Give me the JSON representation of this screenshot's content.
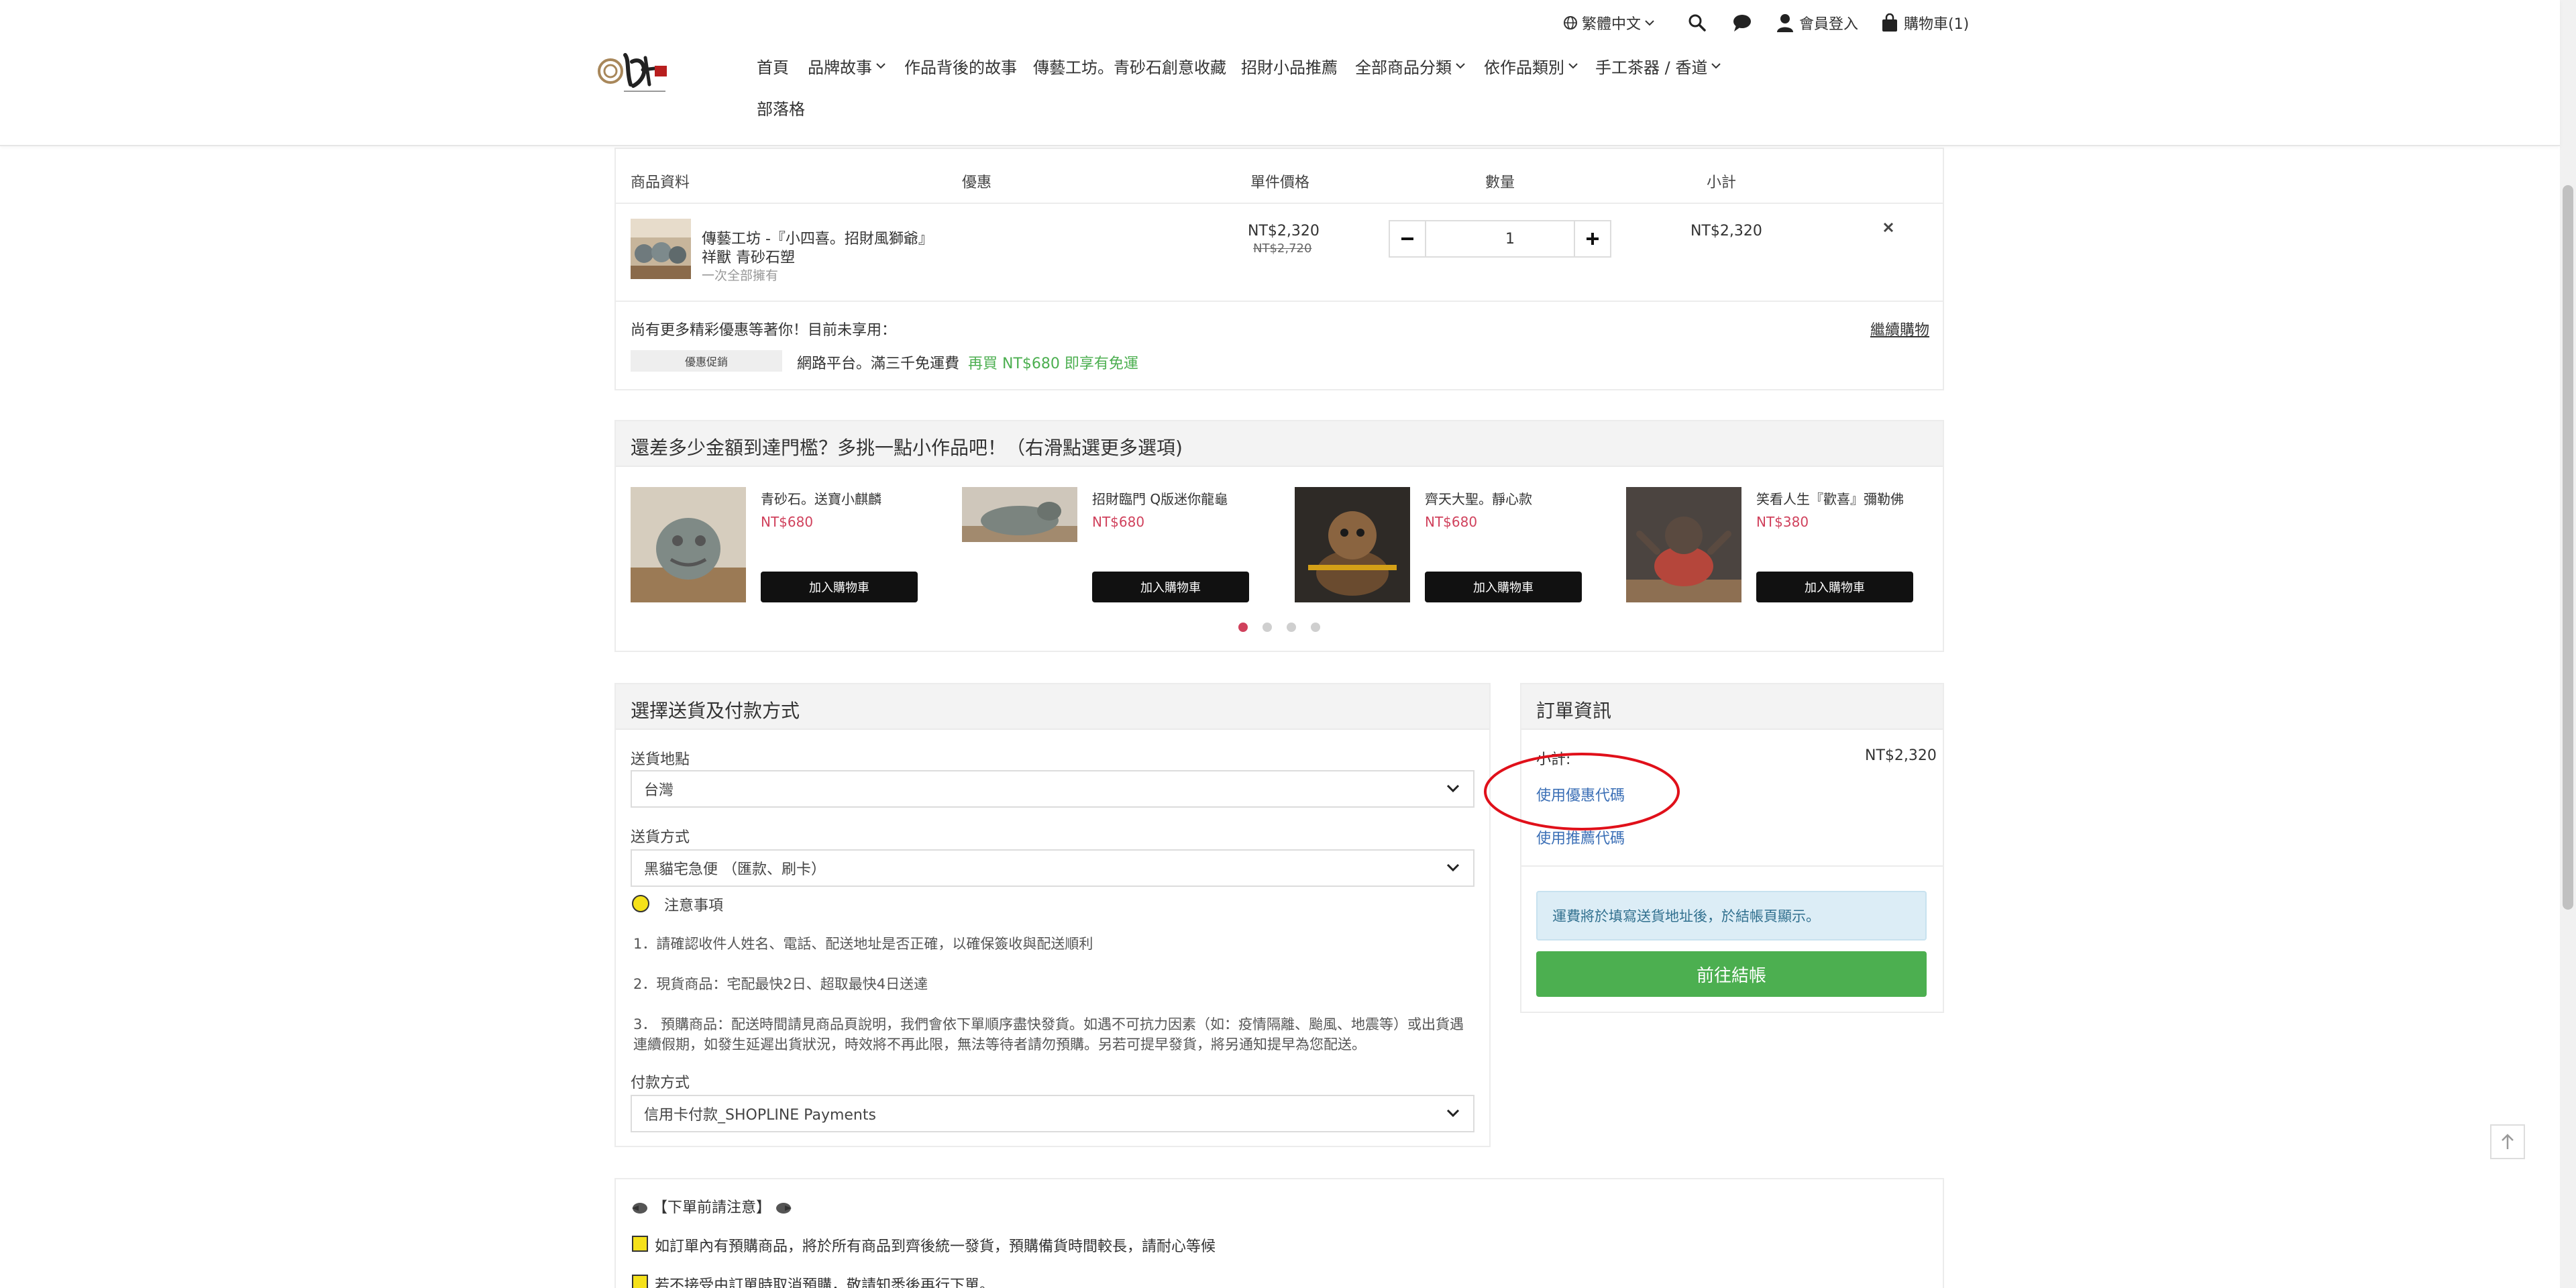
{
  "header": {
    "language": "繁體中文",
    "login": "會員登入",
    "cart": "購物車(1)",
    "nav": [
      "首頁",
      "品牌故事",
      "作品背後的故事",
      "傳藝工坊。青砂石創意收藏",
      "招財小品推薦",
      "全部商品分類",
      "依作品類別",
      "手工茶器 / 香道",
      "部落格"
    ]
  },
  "cart": {
    "columns": {
      "product": "商品資料",
      "discount": "優惠",
      "unit_price": "單件價格",
      "quantity": "數量",
      "subtotal": "小計"
    },
    "item": {
      "name_line1": "傳藝工坊 -『小四喜。招財風獅爺』",
      "name_line2": "祥獸 青砂石塑",
      "variant": "一次全部擁有",
      "price": "NT$2,320",
      "original_price": "NT$2,720",
      "quantity": "1",
      "subtotal": "NT$2,320"
    },
    "promo_notice": "尚有更多精彩優惠等著你！目前未享用：",
    "continue_shopping": "繼續購物",
    "promo_tag": "優惠促銷",
    "promo_text": "網路平台。滿三千免運費",
    "promo_highlight": "再買 NT$680 即享有免運"
  },
  "addons": {
    "title": "還差多少金額到達門檻？多挑一點小作品吧！（右滑點選更多選項)",
    "add_label": "加入購物車",
    "items": [
      {
        "name": "青砂石。送寶小麒麟",
        "price": "NT$680"
      },
      {
        "name": "招財臨門 Q版迷你龍龜",
        "price": "NT$680"
      },
      {
        "name": "齊天大聖。靜心款",
        "price": "NT$680"
      },
      {
        "name": "笑看人生『歡喜』彌勒佛",
        "price": "NT$380"
      }
    ]
  },
  "shipping": {
    "title": "選擇送貨及付款方式",
    "destination_label": "送貨地點",
    "destination_value": "台灣",
    "method_label": "送貨方式",
    "method_value": "黑貓宅急便 （匯款、刷卡）",
    "notice_label": "注意事項",
    "note1": "1．請確認收件人姓名、電話、配送地址是否正確，以確保簽收與配送順利",
    "note2": "2．現貨商品：宅配最快2日、超取最快4日送達",
    "note3a": "3． 預購商品：配送時間請見商品頁說明，我們會依下單順序盡快發貨。如遇不可抗力因素（如：疫情隔離、颱風、地震等）或出貨遇",
    "note3b": "連續假期，如發生延遲出貨狀況，時效將不再此限，無法等待者請勿預購。另若可提早發貨，將另通知提早為您配送。",
    "payment_label": "付款方式",
    "payment_value": "信用卡付款_SHOPLINE Payments"
  },
  "order": {
    "title": "訂單資訊",
    "subtotal_label": "小計:",
    "subtotal_value": "NT$2,320",
    "coupon_link": "使用優惠代碼",
    "referral_link": "使用推薦代碼",
    "shipping_info": "運費將於填寫送貨地址後，於結帳頁顯示。",
    "checkout": "前往結帳"
  },
  "notes": {
    "title": "【下單前請注意】",
    "line1": "如訂單內有預購商品，將於所有商品到齊後統一發貨，預購備貨時間較長，請耐心等候",
    "line2": "若不接受由訂單時取消預購，敬請知悉後再行下單。"
  },
  "colors": {
    "price_red": "#d0415c",
    "link_blue": "#3b6fb6",
    "green": "#4caf50",
    "annotation_red": "#e0101a"
  }
}
